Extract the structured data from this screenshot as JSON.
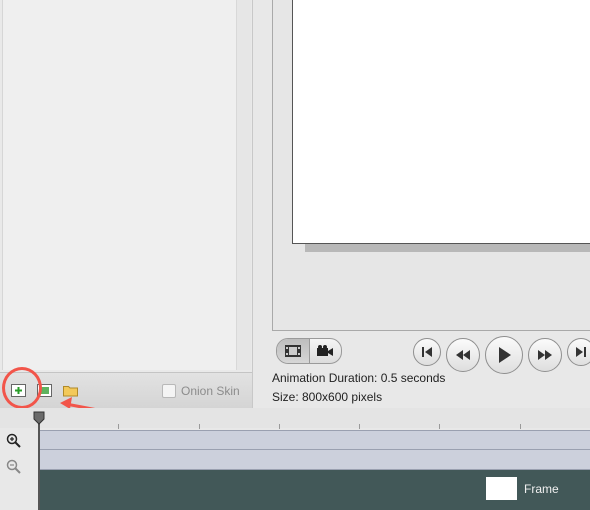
{
  "toolbar": {
    "add_frame_icon": "add-frame-icon",
    "duplicate_frame_icon": "duplicate-frame-icon",
    "folder_icon": "folder-icon",
    "onion_skin_label": "Onion Skin",
    "onion_skin_checked": false
  },
  "view_toggles": [
    "filmstrip-icon",
    "video-camera-icon"
  ],
  "playback": [
    "skip-to-start-icon",
    "rewind-icon",
    "play-icon",
    "fast-forward-icon",
    "skip-to-end-icon"
  ],
  "info": {
    "duration": "Animation Duration: 0.5 seconds",
    "size": "Size: 800x600 pixels"
  },
  "timeline": {
    "zoom_in_icon": "zoom-in-icon",
    "zoom_out_icon": "zoom-out-icon",
    "frame_label": "Frame"
  },
  "colors": {
    "annotation": "#f2554a",
    "track_bg": "#ccd0dc",
    "frame_track": "#425858"
  }
}
